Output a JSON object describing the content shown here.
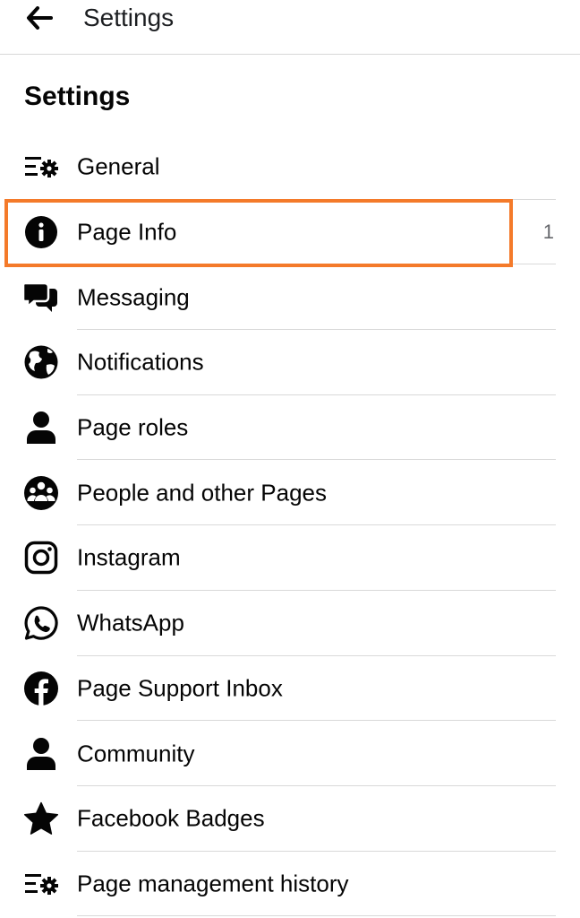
{
  "header": {
    "title": "Settings",
    "back_icon": "arrow-left-icon"
  },
  "section": {
    "title": "Settings"
  },
  "highlight_color": "#f47a2a",
  "items": [
    {
      "label": "General",
      "icon": "settings-list-icon",
      "count": ""
    },
    {
      "label": "Page Info",
      "icon": "info-icon",
      "count": "1",
      "highlighted": true
    },
    {
      "label": "Messaging",
      "icon": "chat-bubbles-icon",
      "count": ""
    },
    {
      "label": "Notifications",
      "icon": "globe-icon",
      "count": ""
    },
    {
      "label": "Page roles",
      "icon": "person-icon",
      "count": ""
    },
    {
      "label": "People and other Pages",
      "icon": "group-icon",
      "count": ""
    },
    {
      "label": "Instagram",
      "icon": "instagram-icon",
      "count": ""
    },
    {
      "label": "WhatsApp",
      "icon": "whatsapp-icon",
      "count": ""
    },
    {
      "label": "Page Support Inbox",
      "icon": "facebook-icon",
      "count": ""
    },
    {
      "label": "Community",
      "icon": "person-icon",
      "count": ""
    },
    {
      "label": "Facebook Badges",
      "icon": "star-icon",
      "count": ""
    },
    {
      "label": "Page management history",
      "icon": "settings-list-icon",
      "count": ""
    }
  ]
}
